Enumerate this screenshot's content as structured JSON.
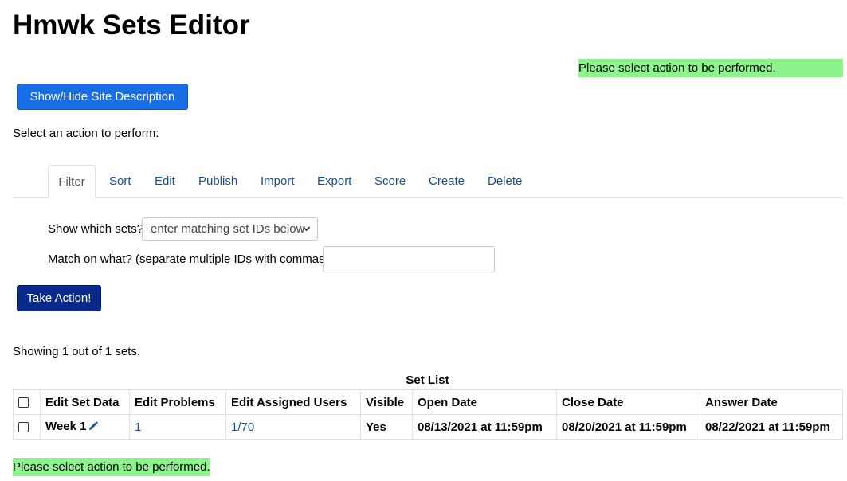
{
  "page_title": "Hmwk Sets Editor",
  "message": "Please select action to be performed.",
  "desc_button": "Show/Hide Site Description",
  "select_action_label": "Select an action to perform:",
  "tabs": [
    "Filter",
    "Sort",
    "Edit",
    "Publish",
    "Import",
    "Export",
    "Score",
    "Create",
    "Delete"
  ],
  "active_tab": "Filter",
  "filter": {
    "show_label": "Show which sets?:",
    "show_value": "enter matching set IDs below",
    "match_label": "Match on what? (separate multiple IDs with commas)",
    "match_required": "*",
    "match_colon": ":",
    "match_value": ""
  },
  "take_action_button": "Take Action!",
  "showing_text": "Showing 1 out of 1 sets.",
  "table": {
    "caption": "Set List",
    "headers": [
      "Edit Set Data",
      "Edit Problems",
      "Edit Assigned Users",
      "Visible",
      "Open Date",
      "Close Date",
      "Answer Date"
    ],
    "rows": [
      {
        "set_name": "Week 1",
        "problems": "1",
        "assigned_users": "1/70",
        "visible": "Yes",
        "open_date": "08/13/2021 at 11:59pm",
        "close_date": "08/20/2021 at 11:59pm",
        "answer_date": "08/22/2021 at 11:59pm"
      }
    ]
  },
  "colors": {
    "message_bg": "#8ef38e",
    "primary_button": "#1a6fe6",
    "action_button": "#0a2a8a",
    "link": "#1b4f8e"
  }
}
